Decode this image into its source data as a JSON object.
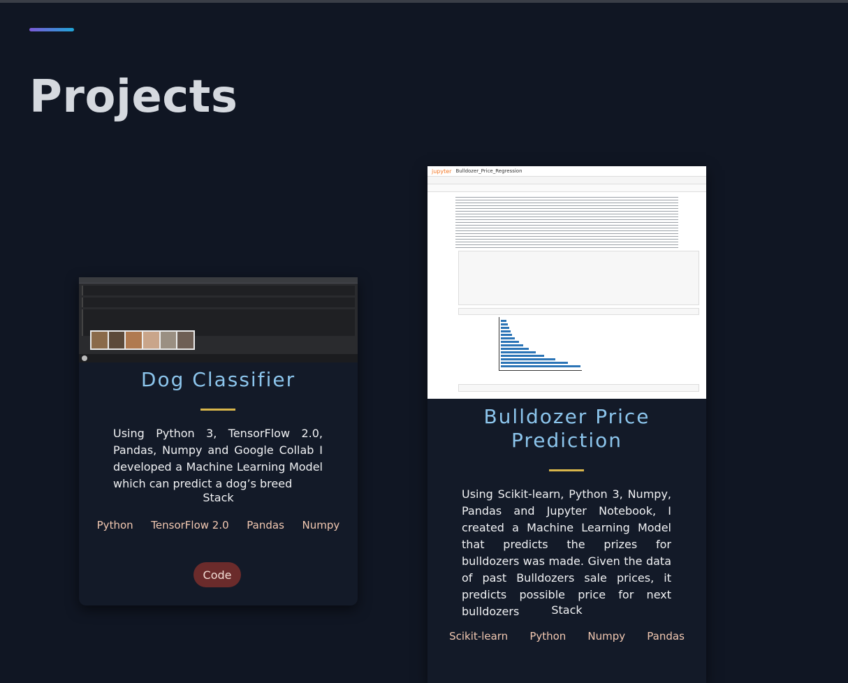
{
  "page": {
    "title": "Projects"
  },
  "projects": [
    {
      "title": "Dog Classifier",
      "description": "Using Python 3, TensorFlow 2.0, Pandas, Numpy and Google Collab I developed a Machine Learning Model which can predict a dog’s breed",
      "stack_label": "Stack",
      "stack": [
        "Python",
        "TensorFlow 2.0",
        "Pandas",
        "Numpy"
      ],
      "button": "Code"
    },
    {
      "title_line1": "Bulldozer Price",
      "title_line2": "Prediction",
      "description": "Using Scikit-learn, Python 3, Numpy, Pandas and Jupyter Notebook, I created a Machine Learning Model that predicts the prizes for bulldozers was made. Given the data of past Bulldozers sale prices, it predicts possible price for next bulldozers",
      "stack_label": "Stack",
      "stack": [
        "Scikit-learn",
        "Python",
        "Numpy",
        "Pandas"
      ]
    }
  ],
  "thumb": {
    "jupyter_brand": "jupyter",
    "notebook_name": "Bulldozer_Price_Regression"
  },
  "colors": {
    "accent_start": "#7c5ad8",
    "accent_end": "#1fa6d8",
    "title_blue": "#8cc5ec",
    "divider_gold": "#d9b64b",
    "button_red": "#6b2b2b"
  }
}
